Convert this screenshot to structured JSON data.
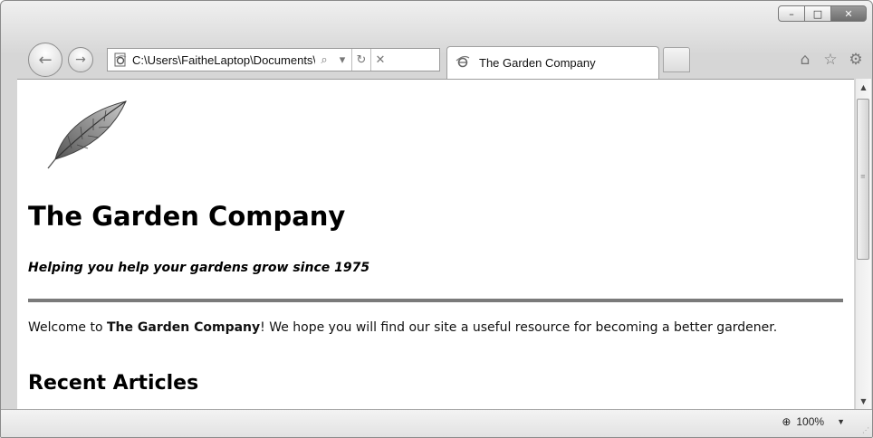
{
  "window": {
    "controls": {
      "minimize_glyph": "–",
      "maximize_glyph": "□",
      "close_glyph": "✕"
    }
  },
  "toolbar": {
    "back_glyph": "←",
    "forward_glyph": "→",
    "address": {
      "value": "C:\\Users\\FaitheLaptop\\Documents\\M",
      "search_glyph": "⌕",
      "dropdown_glyph": "▾",
      "refresh_glyph": "↻",
      "stop_glyph": "✕"
    },
    "tab": {
      "label": "The Garden Company"
    },
    "icons": [
      "home-icon",
      "favorites-star-icon",
      "tools-gear-icon"
    ]
  },
  "page": {
    "title": "The Garden Company",
    "tagline": "Helping you help your gardens grow since 1975",
    "welcome": {
      "prefix": "Welcome to ",
      "bold": "The Garden Company",
      "suffix": "! We hope you will find our site a useful resource for becoming a better gardener."
    },
    "recent_articles_heading": "Recent Articles"
  },
  "statusbar": {
    "zoom": "100%"
  },
  "colors": {
    "chrome": "#d6d6d6",
    "rule": "#7a7a7a",
    "text": "#000000"
  }
}
